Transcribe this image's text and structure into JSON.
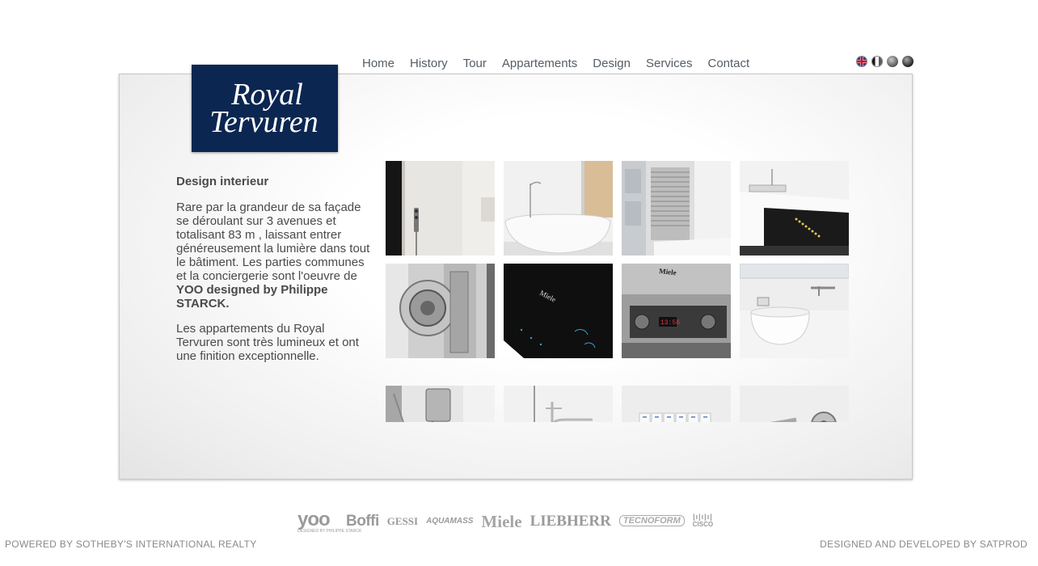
{
  "nav": {
    "items": [
      {
        "label": "Home"
      },
      {
        "label": "History"
      },
      {
        "label": "Tour"
      },
      {
        "label": "Appartements"
      },
      {
        "label": "Design"
      },
      {
        "label": "Services"
      },
      {
        "label": "Contact"
      }
    ]
  },
  "languages": [
    {
      "icon": "uk-flag-icon"
    },
    {
      "icon": "belgium-flag-icon"
    },
    {
      "icon": "language-globe-icon"
    },
    {
      "icon": "language-globe-dark-icon"
    }
  ],
  "logo": {
    "line1": "Royal",
    "line2": "Tervuren",
    "bg_color": "#0b2651"
  },
  "content": {
    "heading": "Design interieur",
    "para1_text": "Rare par la grandeur de sa façade se déroulant sur 3 avenues et totalisant 83 m , laissant entrer généreusement la lumière dans tout le bâtiment. Les parties communes et la conciergerie sont l'oeuvre de ",
    "para1_bold": "YOO designed by Philippe STARCK.",
    "para2": "Les appartements du Royal Tervuren sont très lumineux et ont une finition exceptionnelle."
  },
  "gallery": [
    {
      "name": "shower-thermostat-photo"
    },
    {
      "name": "freestanding-bathtub-photo"
    },
    {
      "name": "towel-radiator-photo"
    },
    {
      "name": "kitchen-cooktop-photo"
    },
    {
      "name": "door-knob-photo"
    },
    {
      "name": "miele-induction-hob-photo"
    },
    {
      "name": "miele-oven-photo"
    },
    {
      "name": "vessel-sink-photo"
    },
    {
      "name": "shower-mixer-photo"
    },
    {
      "name": "basin-faucet-photo"
    },
    {
      "name": "light-switches-photo"
    },
    {
      "name": "wall-faucet-photo"
    }
  ],
  "brands": {
    "yoo": "yoo",
    "yoo_sub": "DESIGNED BY PHILIPPE STARCK",
    "boffi": "Boffi",
    "gessi": "GESSI",
    "aquamass": "AQUAMASS",
    "miele": "Miele",
    "liebherr": "LIEBHERR",
    "tecnoform": "TECNOFORM",
    "cisco": "CISCO"
  },
  "footer": {
    "left": "POWERED BY SOTHEBY'S INTERNATIONAL REALTY",
    "right": "DESIGNED AND DEVELOPED BY SATPROD"
  }
}
